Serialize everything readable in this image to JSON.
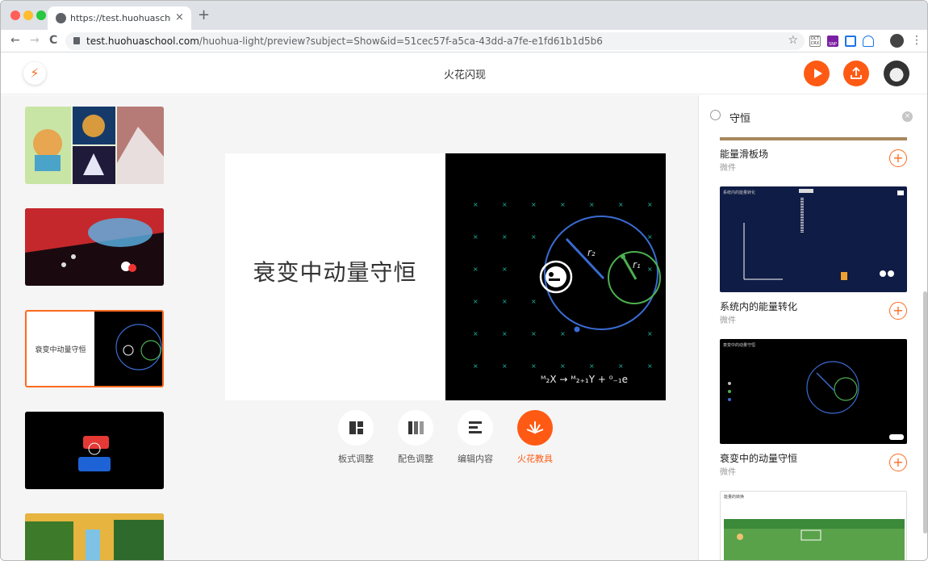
{
  "browser": {
    "tab_title": "https://test.huohuaschool.com",
    "tab_close": "×",
    "new_tab": "+",
    "url_host": "test.huohuaschool.com",
    "url_path": "/huohua-light/preview?subject=Show&id=51cec57f-a5ca-43dd-a7fe-e1fd61b1d5b6",
    "ext_labels": [
      "OCT CRX",
      "SNP"
    ],
    "nav": {
      "back": "←",
      "forward": "→",
      "reload": "C"
    },
    "menu": "⋮"
  },
  "app": {
    "title": "火花闪现",
    "play_icon": "play-icon",
    "upload_icon": "upload-icon",
    "accent": "#ff5a14"
  },
  "slides": [
    {
      "kind": "collage"
    },
    {
      "kind": "concert"
    },
    {
      "kind": "physics",
      "title": "衰变中动量守恒",
      "selected": true
    },
    {
      "kind": "machine"
    },
    {
      "kind": "jungle"
    }
  ],
  "canvas": {
    "slide_title": "衰变中动量守恒",
    "label_r2": "r₂",
    "label_r1": "r₁",
    "formula": "ᴹ₂X → ᴹ₂₊₁Y + ⁰₋₁e"
  },
  "toolbar": [
    {
      "label": "板式调整",
      "icon": "layout-icon",
      "active": false
    },
    {
      "label": "配色调整",
      "icon": "color-icon",
      "active": false
    },
    {
      "label": "编辑内容",
      "icon": "edit-icon",
      "active": false
    },
    {
      "label": "火花教具",
      "icon": "spark-tool-icon",
      "active": true
    }
  ],
  "search": {
    "value": "守恒",
    "clear": "×"
  },
  "results": [
    {
      "name": "能量滑板场",
      "type": "微件"
    },
    {
      "name": "系统内的能量转化",
      "type": "微件",
      "img_title": "系统内的能量转化"
    },
    {
      "name": "衰变中的动量守恒",
      "type": "微件",
      "img_title": "衰变中的动量守恒"
    },
    {
      "name": "",
      "type": "",
      "img_title": "能量的转换"
    }
  ]
}
